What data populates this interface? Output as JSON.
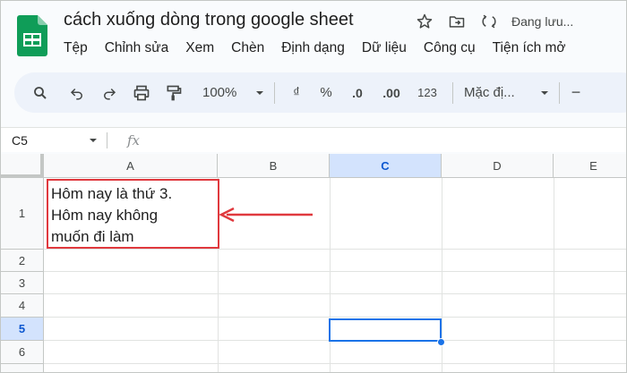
{
  "header": {
    "title": "cách xuống dòng trong google sheet",
    "saving_status": "Đang lưu...",
    "icons": [
      "star-icon",
      "move-to-folder-icon",
      "sync-icon"
    ]
  },
  "menu": {
    "items": [
      "Tệp",
      "Chỉnh sửa",
      "Xem",
      "Chèn",
      "Định dạng",
      "Dữ liệu",
      "Công cụ",
      "Tiện ích mở"
    ]
  },
  "toolbar": {
    "zoom": "100%",
    "currency": "₫",
    "percent": "%",
    "decrease_decimal": ".0",
    "increase_decimal": ".00",
    "number_format": "123",
    "font": "Mặc đị...",
    "minus": "−"
  },
  "formula_bar": {
    "cell_ref": "C5",
    "fx": "fx"
  },
  "grid": {
    "columns": [
      "A",
      "B",
      "C",
      "D",
      "E"
    ],
    "rows": [
      "1",
      "2",
      "3",
      "4",
      "5",
      "6"
    ],
    "selected_column": "C",
    "selected_row": "5",
    "cell_a1_lines": [
      "Hôm nay là thứ 3.",
      "Hôm nay không",
      "muốn đi làm"
    ]
  },
  "colors": {
    "accent": "#1a73e8",
    "highlight_red": "#e0393e",
    "toolbar_bg": "#edf2fa",
    "selected_header_bg": "#d3e3fd"
  }
}
